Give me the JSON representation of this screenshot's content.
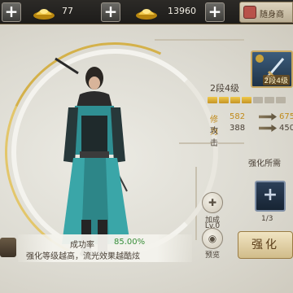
{
  "currency": {
    "gold_amount": "77",
    "ingot_amount": "13960",
    "add_symbol": "+"
  },
  "bag": {
    "label": "随身商"
  },
  "item": {
    "badge": "2段4级"
  },
  "level": {
    "label": "2段4级",
    "stars_filled": 4,
    "stars_total": 7
  },
  "stats": {
    "cultivation": {
      "name": "修为",
      "current": "582",
      "next": "675"
    },
    "attack": {
      "name": "攻击",
      "current": "388",
      "next": "450"
    }
  },
  "requirement": {
    "title": "强化所需",
    "count": "1/3",
    "plus": "+"
  },
  "actions": {
    "enhance_label": "强化",
    "add_success_label": "加成",
    "add_success_sub": "Lv.0",
    "preview_label": "预览"
  },
  "rate": {
    "label": "成功率",
    "value": "85.00%",
    "hint": "强化等级越高，流光效果越酷炫"
  },
  "colors": {
    "gold": "#c08a1a",
    "success_green": "#3a8f3a",
    "ring_gold": "#d4b14a"
  }
}
